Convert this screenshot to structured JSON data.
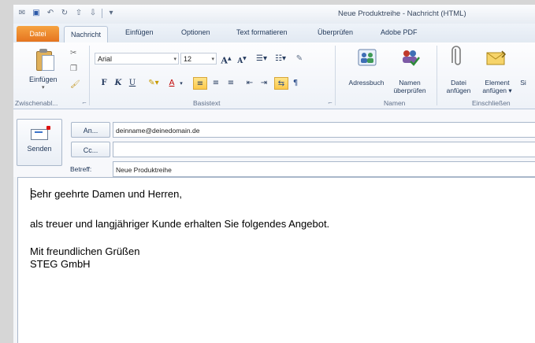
{
  "window": {
    "title": "Neue Produktreihe  -  Nachricht (HTML)"
  },
  "tabs": [
    {
      "label": "Datei"
    },
    {
      "label": "Nachricht"
    },
    {
      "label": "Einfügen"
    },
    {
      "label": "Optionen"
    },
    {
      "label": "Text formatieren"
    },
    {
      "label": "Überprüfen"
    },
    {
      "label": "Adobe PDF"
    }
  ],
  "ribbon": {
    "clipboard": {
      "paste_label": "Einfügen",
      "group_label": "Zwischenabl..."
    },
    "basic_text": {
      "font_name": "Arial",
      "font_size": "12",
      "bold": "F",
      "italic": "K",
      "underline": "U",
      "font_color": "A",
      "group_label": "Basistext"
    },
    "names": {
      "address_book": "Adressbuch",
      "check_names_line1": "Namen",
      "check_names_line2": "überprüfen",
      "group_label": "Namen"
    },
    "include": {
      "attach_file_line1": "Datei",
      "attach_file_line2": "anfügen",
      "attach_item_line1": "Element",
      "attach_item_line2": "anfügen ▾",
      "cut_label": "Si",
      "group_label": "Einschließen"
    }
  },
  "compose": {
    "send_label": "Senden",
    "to_label": "An...",
    "to_value": "deinname@deinedomain.de",
    "cc_label": "Cc...",
    "cc_value": "",
    "subject_label": "Betreff:",
    "subject_value": "Neue Produktreihe"
  },
  "body": {
    "greeting": "Sehr geehrte Damen und Herren,",
    "paragraph": "als treuer und langjähriger Kunde erhalten Sie folgendes Angebot.",
    "closing": "Mit freundlichen Grüßen",
    "signature": "STEG GmbH"
  },
  "colors": {
    "file_tab": "#e5741f",
    "highlight": "#fcc94b",
    "font_color_red": "#c00000"
  }
}
